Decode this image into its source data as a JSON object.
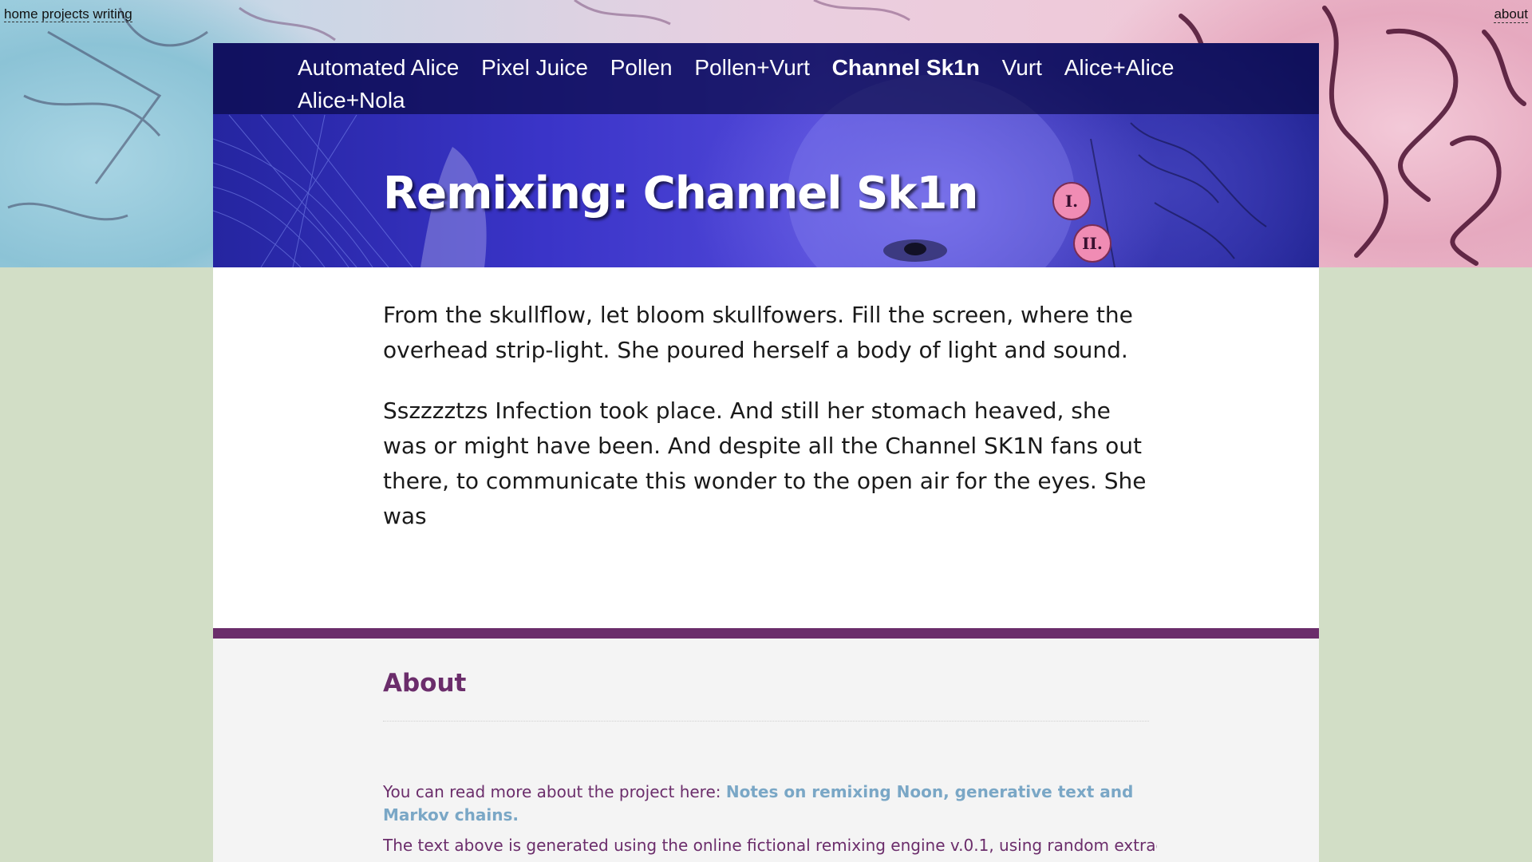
{
  "top_nav": {
    "links": [
      "home",
      "projects",
      "writing"
    ],
    "about": "about"
  },
  "hero": {
    "nav": [
      "Automated Alice",
      "Pixel Juice",
      "Pollen",
      "Pollen+Vurt",
      "Channel Sk1n",
      "Vurt",
      "Alice+Alice",
      "Alice+Nola"
    ],
    "active_nav": "Channel Sk1n",
    "title": "Remixing: Channel Sk1n",
    "badges": [
      "I.",
      "II."
    ]
  },
  "content": {
    "paragraphs": [
      "From the skullflow, let bloom skullfowers. Fill the screen, where the overhead strip-light. She poured herself a body of light and sound.",
      "Sszzzztzs Infection took place. And still her stomach heaved, she was or might have been. And despite all the Channel SK1N fans out there, to communicate this wonder to the open air for the eyes. She was"
    ]
  },
  "about": {
    "heading": "About",
    "para1_prefix": "You can read more about the project here: ",
    "para1_link": "Notes on remixing Noon, generative text and Markov chains.",
    "para2": "The text above is generated using the online fictional remixing engine v.0.1, using random extracts"
  },
  "colors": {
    "page_bg": "#d2dec6",
    "about_accent": "#6b2d6b",
    "link": "#7aa7c6",
    "hero_nav_bg": "#0a0a46"
  }
}
